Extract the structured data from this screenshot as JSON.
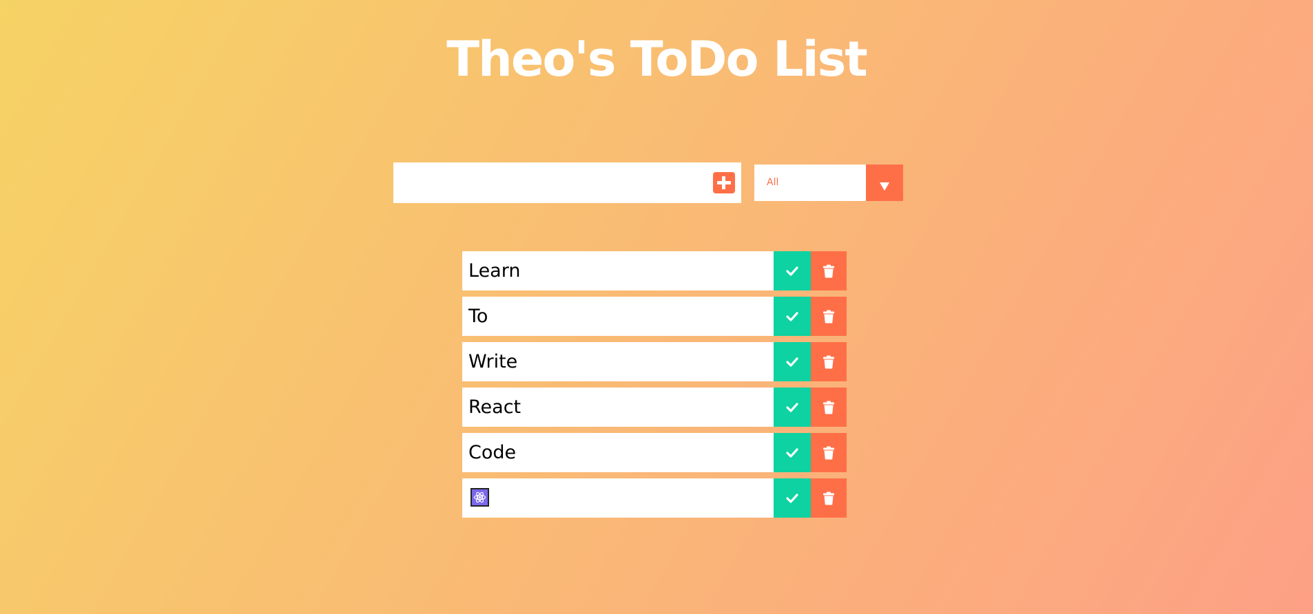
{
  "header": {
    "title": "Theo's ToDo List"
  },
  "form": {
    "input_value": "",
    "add_icon": "plus-square-icon"
  },
  "filter": {
    "selected": "All",
    "arrow_icon": "caret-down-icon"
  },
  "todos": [
    {
      "text": "Learn"
    },
    {
      "text": "To"
    },
    {
      "text": "Write"
    },
    {
      "text": "React"
    },
    {
      "text": "Code"
    },
    {
      "text": "",
      "icon": "react-atom-icon"
    }
  ],
  "item_actions": {
    "complete_icon": "check-icon",
    "delete_icon": "trash-icon"
  },
  "colors": {
    "gradient_start": "#f6d365",
    "gradient_end": "#fda085",
    "accent": "#ff6f47",
    "complete": "#0ed2a1",
    "badge": "#7b68ee"
  }
}
